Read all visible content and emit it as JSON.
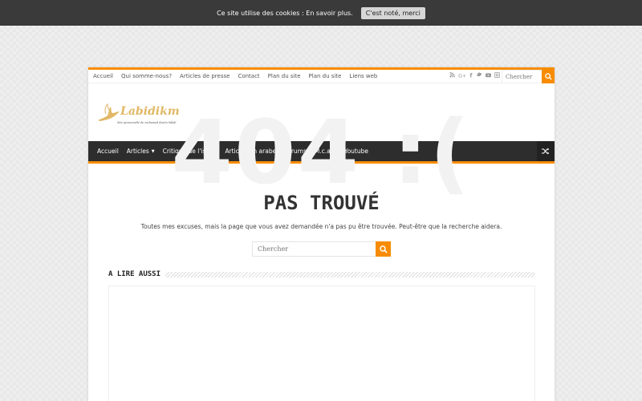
{
  "cookie": {
    "text": "Ce site utilise des cookies : ",
    "link": "En savoir plus.",
    "button": "C'est noté, merci"
  },
  "top_nav": {
    "items": [
      "Accueil",
      "Qui somme-nous?",
      "Articles de presse",
      "Contact",
      "Plan du site",
      "Plan du site",
      "Liens web"
    ],
    "search_placeholder": "Chercher"
  },
  "logo": {
    "name": "Labidikm",
    "tagline": "Site personnelle de mohamed Karim labidi"
  },
  "main_nav": {
    "items": [
      "Accueil",
      "Articles",
      "Critique de l'islam",
      "Articles en arabe",
      "Forums",
      "M.c.a.n",
      "Youtube"
    ]
  },
  "not_found": {
    "big": "404 :(",
    "title": "PAS TROUVÉ",
    "message": "Toutes mes excuses, mais la page que vous avez demandée n'a pas pu être trouvée. Peut-être que la recherche aidera.",
    "search_placeholder": "Chercher"
  },
  "also_read": {
    "label": "A LIRE AUSSI"
  },
  "colors": {
    "accent": "#f88c00",
    "nav_bg": "#2d2d2d",
    "cookie_bg": "#3a3a3a"
  }
}
